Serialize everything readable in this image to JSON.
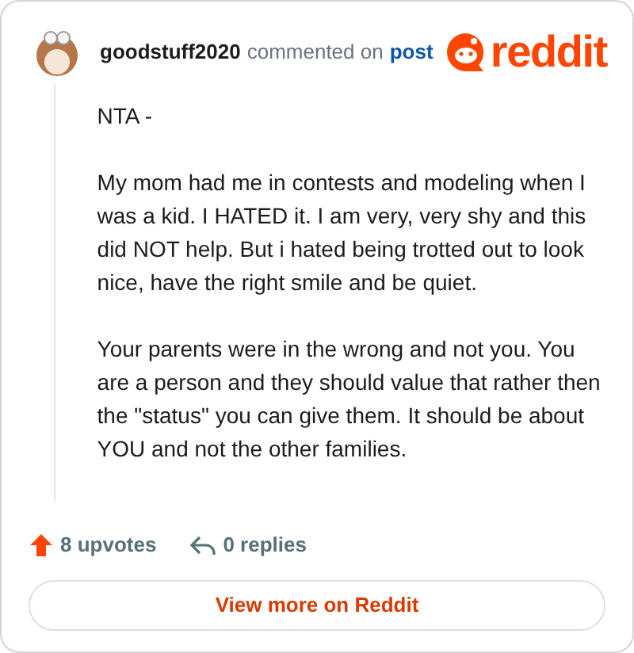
{
  "header": {
    "author": "goodstuff2020",
    "action": "commented on",
    "link": "post",
    "logo_text": "reddit"
  },
  "comment": {
    "paragraphs": [
      "NTA -",
      "My mom had me in contests and modeling when I was a kid. I HATED it. I am very, very shy and this did NOT help. But i hated being trotted out to look nice, have the right smile and be quiet.",
      "Your parents were in the wrong and not you. You are a person and they should value that rather then the \"status\" you can give them. It should be about YOU and not the other families."
    ]
  },
  "footer": {
    "upvotes": "8 upvotes",
    "replies": "0 replies"
  },
  "button": {
    "label": "View more on Reddit"
  }
}
